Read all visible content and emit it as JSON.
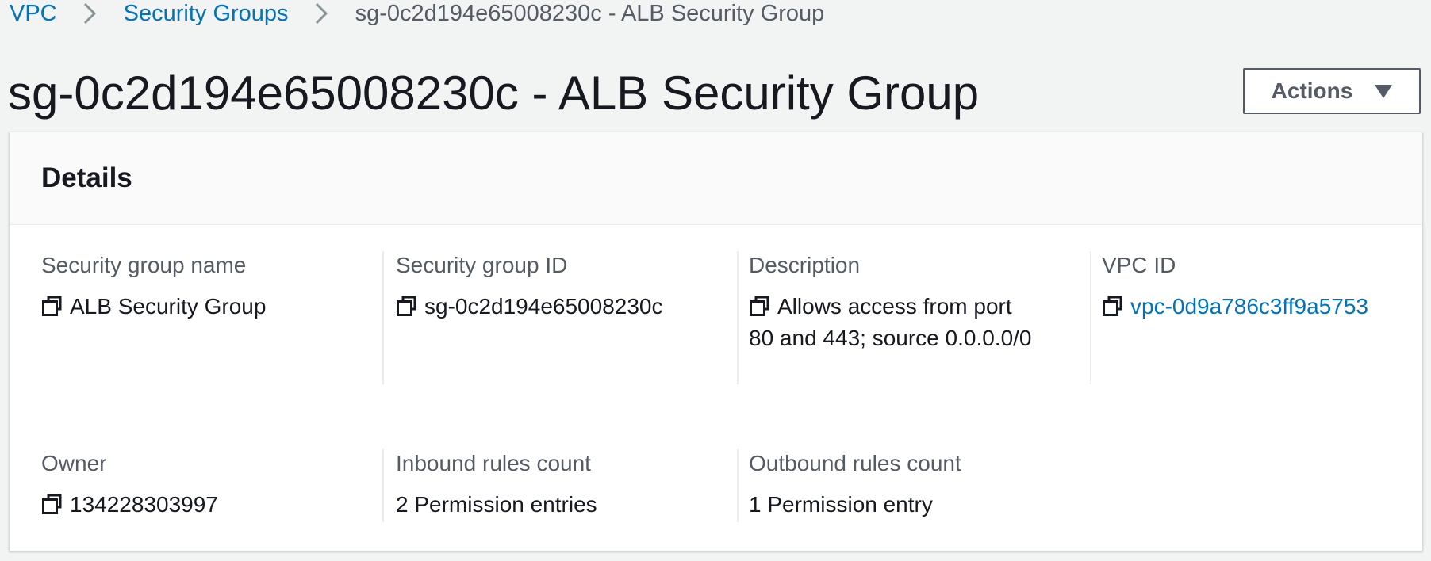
{
  "breadcrumb": {
    "items": [
      {
        "label": "VPC"
      },
      {
        "label": "Security Groups"
      },
      {
        "label": "sg-0c2d194e65008230c - ALB Security Group"
      }
    ]
  },
  "header": {
    "title": "sg-0c2d194e65008230c - ALB Security Group",
    "actions_label": "Actions"
  },
  "details": {
    "title": "Details",
    "fields": [
      {
        "label": "Security group name",
        "value": "ALB Security Group",
        "copyable": true,
        "link": false
      },
      {
        "label": "Security group ID",
        "value": "sg-0c2d194e65008230c",
        "copyable": true,
        "link": false
      },
      {
        "label": "Description",
        "value": "Allows access from port 80 and 443; source 0.0.0.0/0",
        "copyable": true,
        "link": false
      },
      {
        "label": "VPC ID",
        "value": "vpc-0d9a786c3ff9a5753",
        "copyable": true,
        "link": true
      },
      {
        "label": "Owner",
        "value": "134228303997",
        "copyable": true,
        "link": false
      },
      {
        "label": "Inbound rules count",
        "value": "2 Permission entries",
        "copyable": false,
        "link": false
      },
      {
        "label": "Outbound rules count",
        "value": "1 Permission entry",
        "copyable": false,
        "link": false
      }
    ]
  },
  "icons": {
    "breadcrumb_separator": "chevron-right-icon",
    "actions_caret": "caret-down-icon",
    "copy": "copy-icon"
  },
  "colors": {
    "link": "#0073bb",
    "page_background": "#f2f3f3",
    "text": "#16191f",
    "secondary_text": "#545b64"
  }
}
